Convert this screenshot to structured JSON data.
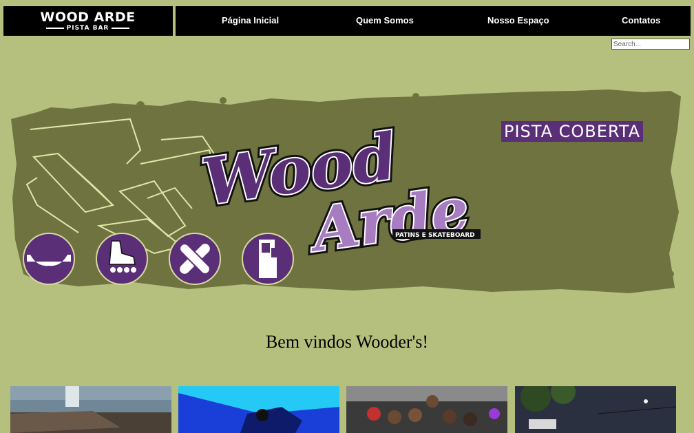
{
  "brand": {
    "name": "WOOD ARDE",
    "sub": "PISTA BAR"
  },
  "nav": {
    "items": [
      {
        "label": "Página Inicial"
      },
      {
        "label": "Quem Somos"
      },
      {
        "label": "Nosso Espaço"
      },
      {
        "label": "Contatos"
      }
    ]
  },
  "search": {
    "placeholder": "Search...",
    "value": ""
  },
  "hero": {
    "tag": "PISTA COBERTA",
    "logo_line1": "Wood",
    "logo_line2": "Arde",
    "logo_tagline": "PATINS E SKATEBOARD",
    "icons": [
      "halfpipe-icon",
      "roller-skate-icon",
      "skateboards-icon",
      "arcade-icon"
    ]
  },
  "welcome": {
    "text": "Bem vindos Wooder's!"
  },
  "colors": {
    "background": "#b5c07e",
    "hero_green": "#6e7340",
    "accent_purple": "#5b2f78",
    "light_purple": "#a77cc0",
    "nav_bg": "#000000"
  }
}
